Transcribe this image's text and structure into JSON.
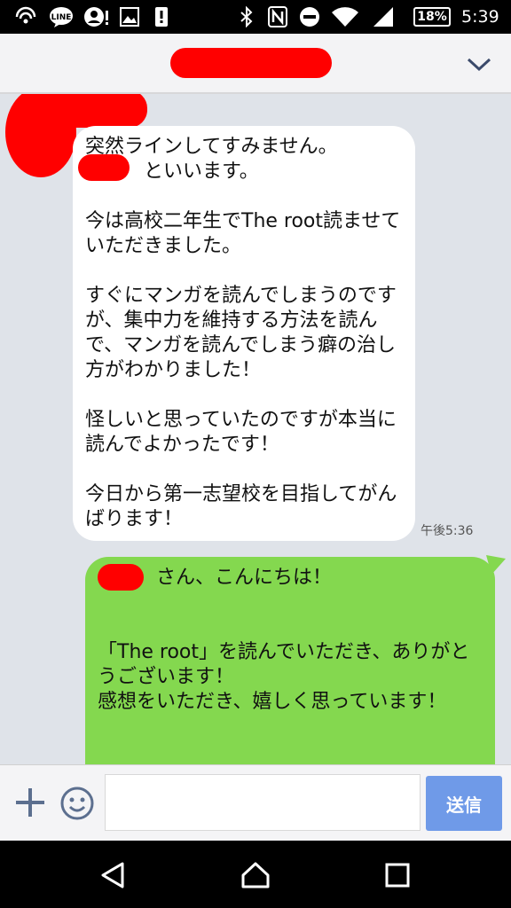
{
  "status_bar": {
    "icons": [
      "wifi-calling-icon",
      "line-notification-icon",
      "account-alert-icon",
      "image-icon",
      "alert-icon",
      "bluetooth-icon",
      "nfc-icon",
      "do-not-disturb-icon",
      "wifi-icon",
      "signal-icon"
    ],
    "battery": "18%",
    "time": "5:39"
  },
  "chat": {
    "received": {
      "text": "突然ラインしてすみません。\n　　　といいます。\n\n今は高校二年生でThe root読ませていただきました。\n\nすぐにマンガを読んでしまうのですが、集中力を維持する方法を読んで、マンガを読んでしまう癖の治し方がわかりました！\n\n怪しいと思っていたのですが本当に読んでよかったです！\n\n今日から第一志望校を目指してがんばります！",
      "time": "午後5:36"
    },
    "sent": {
      "text": "　　　さん、こんにちは！\n\n\n「The root」を読んでいただき、ありがとうございます！\n感想をいただき、嬉しく思っています！"
    }
  },
  "input_bar": {
    "placeholder": "",
    "send_label": "送信"
  },
  "colors": {
    "sent_bubble": "#84d84f",
    "received_bubble": "#ffffff",
    "chat_background": "#dfe3e9",
    "send_button": "#6f9ae8"
  }
}
